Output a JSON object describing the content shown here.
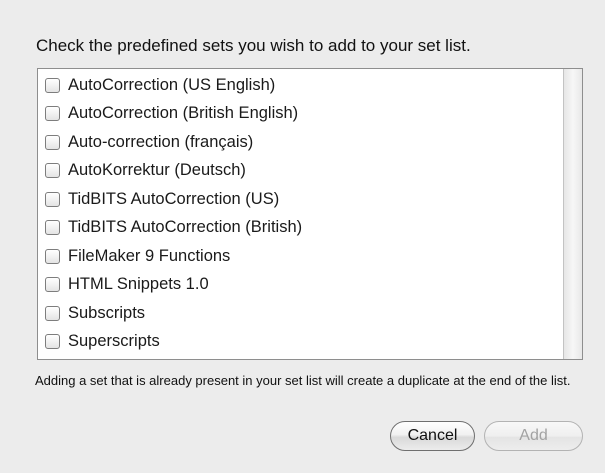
{
  "dialog": {
    "prompt": "Check the predefined sets you wish to add to your set list.",
    "sets": [
      {
        "label": "AutoCorrection (US English)",
        "checked": false
      },
      {
        "label": "AutoCorrection (British English)",
        "checked": false
      },
      {
        "label": "Auto-correction (français)",
        "checked": false
      },
      {
        "label": "AutoKorrektur (Deutsch)",
        "checked": false
      },
      {
        "label": "TidBITS AutoCorrection (US)",
        "checked": false
      },
      {
        "label": "TidBITS AutoCorrection (British)",
        "checked": false
      },
      {
        "label": "FileMaker 9 Functions",
        "checked": false
      },
      {
        "label": "HTML Snippets 1.0",
        "checked": false
      },
      {
        "label": "Subscripts",
        "checked": false
      },
      {
        "label": "Superscripts",
        "checked": false
      }
    ],
    "note": "Adding a set that is already present in your set list will create a duplicate at the end of the list.",
    "cancel_label": "Cancel",
    "add_label": "Add",
    "add_enabled": false
  }
}
